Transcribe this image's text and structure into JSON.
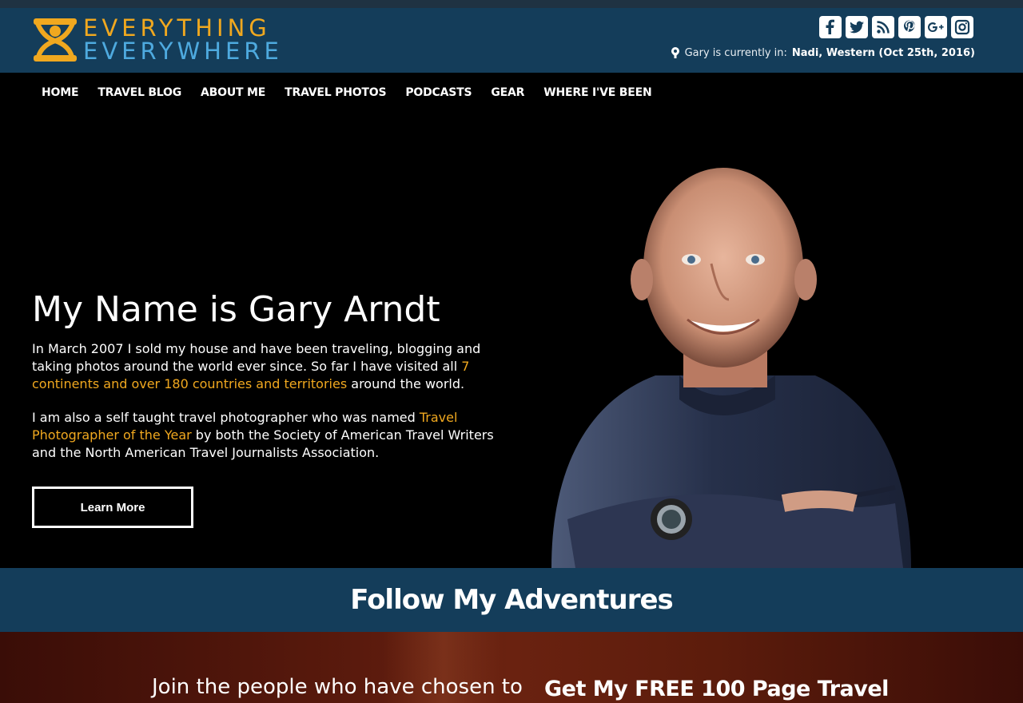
{
  "brand": {
    "line1": "EVERYTHING",
    "line2": "EVERYWHERE",
    "colors": {
      "orange": "#f0a81f",
      "blue": "#4eaadf",
      "header_bg": "#143d5a"
    }
  },
  "social_icons": [
    "facebook-icon",
    "twitter-icon",
    "rss-icon",
    "pinterest-icon",
    "google-plus-icon",
    "instagram-icon"
  ],
  "location": {
    "label": "Gary is currently in:",
    "place": "Nadi, Western (Oct 25th, 2016)"
  },
  "nav": {
    "items": [
      "HOME",
      "TRAVEL BLOG",
      "ABOUT ME",
      "TRAVEL PHOTOS",
      "PODCASTS",
      "GEAR",
      "WHERE I'VE BEEN"
    ]
  },
  "hero": {
    "title": "My Name is Gary Arndt",
    "p1_before": "In March 2007 I sold my house and have been traveling, blogging and taking photos around the world ever since. So far I have visited all ",
    "p1_link": "7 continents and over 180 countries and territories",
    "p1_after": " around the world.",
    "p2_before": "I am also a self taught travel photographer who was named ",
    "p2_link": "Travel Photographer of the Year",
    "p2_after": " by both the Society of American Travel Writers and the North American Travel Journalists Association.",
    "button": "Learn More"
  },
  "follow": {
    "title": "Follow My Adventures"
  },
  "bottom": {
    "join": "Join the people who have chosen to",
    "free": "Get My FREE 100 Page Travel"
  }
}
